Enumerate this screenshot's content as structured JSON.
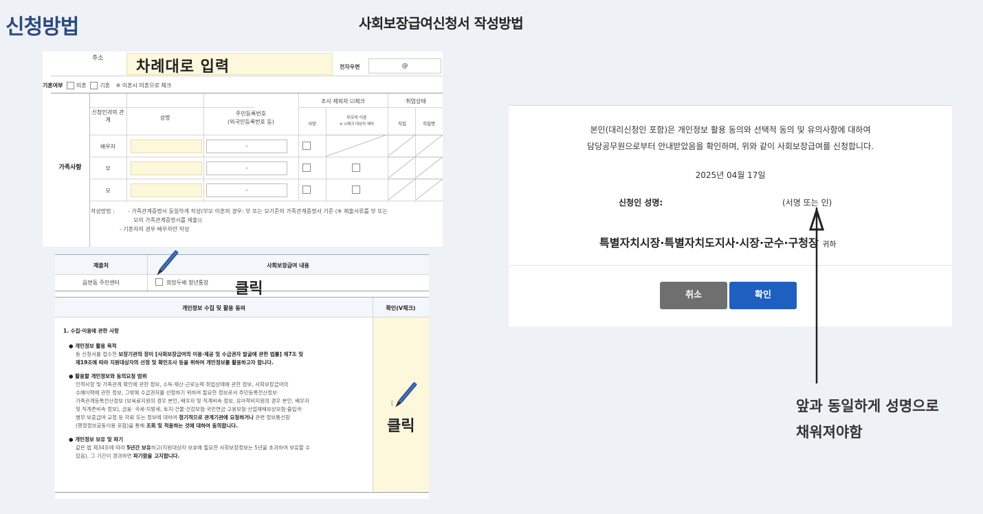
{
  "page": {
    "title": "신청방법",
    "heading": "사회보장급여신청서 작성방법"
  },
  "address": {
    "label": "주소",
    "hint": "차례대로 입력",
    "email_label": "전자우편",
    "email_at": "@"
  },
  "marital": {
    "label": "기혼여부",
    "single": "미혼",
    "married": "기혼",
    "note": "※ 이혼시 미혼으로 체크"
  },
  "family": {
    "section_label": "가족사항",
    "headers": {
      "relation": "신청인과의 관계",
      "name": "성명",
      "rrn": "주민등록번호",
      "rrn_sub": "(외국인등록번호 등)",
      "exclude": "조사 제외자 ☑체크",
      "death": "사망",
      "divorce": "부모의 이혼",
      "divorce_sub": "※ ☑체크 대상자 제외",
      "employment": "취업상태",
      "employed": "직업",
      "job_seeker": "직업명"
    },
    "rows": [
      {
        "relation": "배우자",
        "rrn": "-"
      },
      {
        "relation": "부",
        "rrn": "-"
      },
      {
        "relation": "모",
        "rrn": "-"
      }
    ],
    "note_label": "작성방법 :",
    "note_1": "- 가족관계증명서 동일하게 작성(부모 이혼의 경우: 부 또는 모기준의 가족관계증명서 기준 (※ 제출서류를 부 또는",
    "note_2": "모의 가족관계증명서를 제출))",
    "note_3": "- 기혼자의 경우 배우자만 작성"
  },
  "submission": {
    "col_office": "제출처",
    "col_content": "사회보장급여 내용",
    "office": "읍면동 주민센터",
    "benefit": "희망두배 청년통장",
    "click": "클릭"
  },
  "consent": {
    "header": "개인정보 수집 및 활용 동의",
    "check_header": "확인(V체크)",
    "s1": "1. 수집·이용에 관한 사항",
    "b1_title": "● 개인정보 활용 목적",
    "b1_l1_a": "동 신청서를 접수한 ",
    "b1_l1_b": "보장기관의 장이 [사회보장급여의 이용·제공 및 수급권자 발굴에 관한 법률] 제7조 및",
    "b1_l2": "제19조에 따라 지원대상자의 선정 및 확인조사 등을 위하여 개인정보를 활용하고자 합니다.",
    "b2_title": "● 활용할 개인정보와 동의요청 범위",
    "b2_l1": "인적사항 및 가족관계 확인에 관한 정보, 소득·재산·근로능력·취업상태에 관한 정보, 사회보장급여의",
    "b2_l2": "수혜이력에 관한 정보, 그밖에 수급권자를 선정하기 위하여 필요한 정보로서 주민등록전산정보·",
    "b2_l3": "가족관계등록전산정보 (보육료지원의 경우 본인, 배우자 및 직계비속 정보, 유아학비지원의 경우 본인, 배우자",
    "b2_l4": "및 직계존비속 정보), 금융· 국세·지방세, 토지·건물·건강보험·국민연금·고용보험·산업재해보상보험·출입국·",
    "b2_l5": "병무·보훈급여·교정 등 자료 또는 정보에 대하여 ",
    "b2_l5_b": "정기적으로 관계기관에 요청하거나",
    "b2_l5_c": " 관련 정보통신망",
    "b2_l6_a": "(행정정보공동이용 포함)을 통해 ",
    "b2_l6_b": "조회 및 적용하는 것에 대하여 동의합니다.",
    "b3_title": "● 개인정보 보유 및 파기",
    "b3_l1_a": "같은 법 제34조에 따라 ",
    "b3_l1_b": "5년간 보유",
    "b3_l1_c": "하고(지원대상자 보호에 필요한 사회보장정보는 5년을 초과하여 보유할 수",
    "b3_l2_a": "있음), 그 기간이 경과하면 ",
    "b3_l2_b": "파기함을 고지합니다.",
    "check_bracket": "[",
    "click": "클릭"
  },
  "dialog": {
    "line1": "본인(대리신청인 포함)은 개인정보 활용 동의와 선택적 동의 및 유의사항에 대하여",
    "line2": "담당공무원으로부터 안내받았음을 확인하며, 위와 같이 사회보장급여를 신청합니다.",
    "date": "2025년 04월 17일",
    "applicant_label": "신청인 성명:",
    "signature": "(서명 또는 인)",
    "recipient": "특별자치시장·특별자치도지사·시장·군수·구청장",
    "recipient_suffix": "귀하",
    "cancel": "취소",
    "confirm": "확인"
  },
  "annotation": {
    "line1": "앞과 동일하게 성명으로",
    "line2": "채워져야함"
  },
  "colors": {
    "title_blue": "#2a4a7f",
    "input_yellow": "#fdf8dc",
    "confirm_blue": "#1f5fbf",
    "cancel_gray": "#6f6f6f"
  }
}
